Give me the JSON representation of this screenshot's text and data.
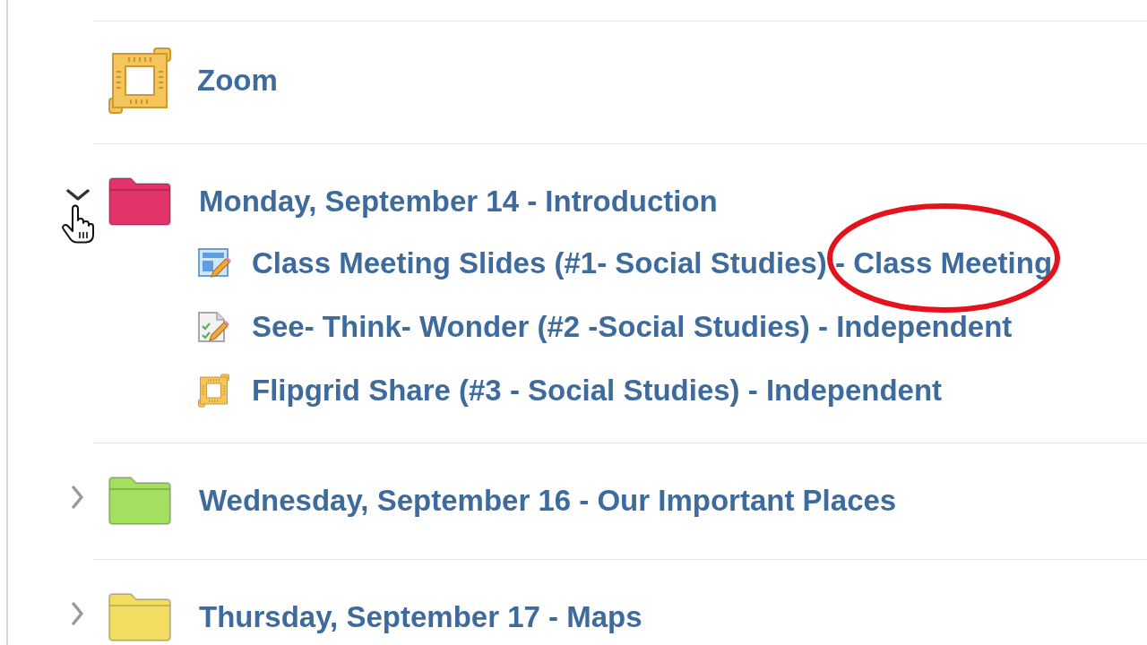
{
  "modules": [
    {
      "kind": "tool",
      "title": "Zoom"
    },
    {
      "kind": "folder",
      "title": "Monday, September 14 - Introduction",
      "color": "#e2336b",
      "expanded": true,
      "hovered": true,
      "children": [
        {
          "kind": "slides",
          "title": "Class Meeting Slides (#1- Social Studies) - Class Meeting",
          "circled": true
        },
        {
          "kind": "assignment",
          "title": "See- Think- Wonder (#2 -Social Studies) - Independent",
          "circled": false
        },
        {
          "kind": "tool",
          "title": "Flipgrid Share (#3 - Social Studies) - Independent",
          "circled": false
        }
      ]
    },
    {
      "kind": "folder",
      "title": "Wednesday, September 16 - Our Important Places",
      "color": "#a3e060",
      "expanded": false,
      "hovered": false
    },
    {
      "kind": "folder",
      "title": "Thursday, September 17 - Maps",
      "color": "#f2dc62",
      "expanded": false,
      "hovered": false
    }
  ]
}
